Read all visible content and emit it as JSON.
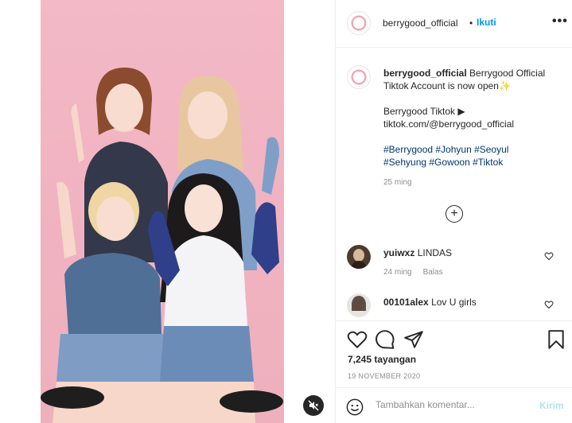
{
  "post": {
    "username": "berrygood_official",
    "separator": "•",
    "follow_label": "Ikuti",
    "more_label": "•••"
  },
  "caption": {
    "username": "berrygood_official",
    "line1": " Berrygood Official Tiktok Account is now open✨",
    "line2": "Berrygood Tiktok ▶",
    "line3": "tiktok.com/@berrygood_official",
    "hashtags_line1": "#Berrygood #Johyun #Seoyul",
    "hashtags_line2": "#Sehyung #Gowoon #Tiktok",
    "time": "25 ming"
  },
  "comments": [
    {
      "username": "yuiwxz",
      "text": "LINDAS",
      "time": "24 ming",
      "reply_label": "Balas"
    },
    {
      "username": "00101alex",
      "text": "Lov U girls"
    }
  ],
  "stats": {
    "views": "7,245 tayangan",
    "date": "19 NOVEMBER 2020"
  },
  "composer": {
    "placeholder": "Tambahkan komentar...",
    "post_label": "Kirim"
  },
  "colors": {
    "accent": "#0095f6",
    "video_bg": "#f2b5c3",
    "hashtag": "#00376b",
    "muted": "#8e8e8e"
  }
}
